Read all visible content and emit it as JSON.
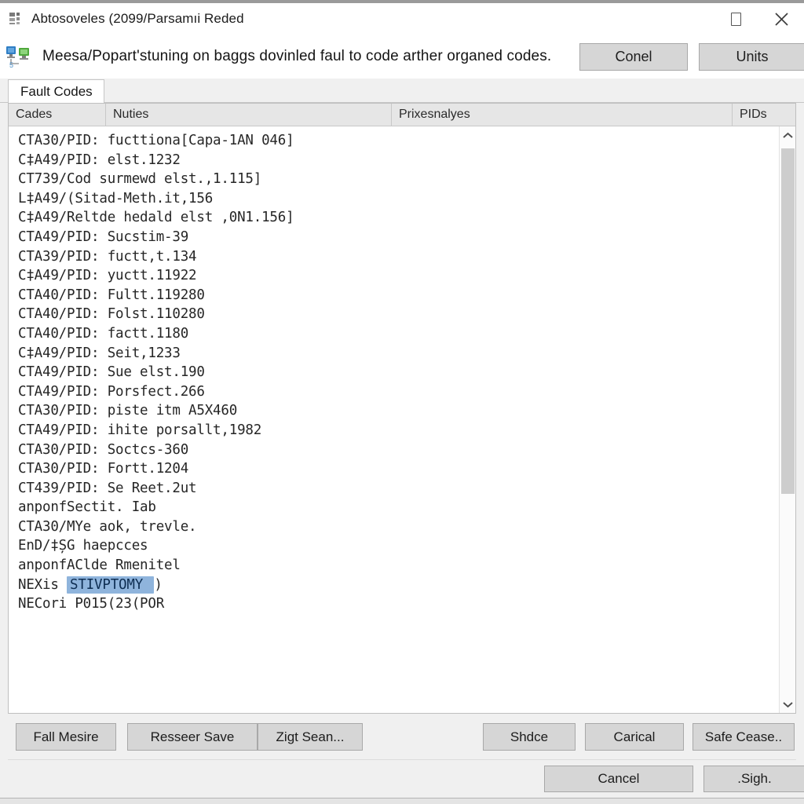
{
  "window": {
    "title": "Abtosoveles (2099/Parsamıi Reded",
    "title_icon": "app-grid-icon",
    "controls": {
      "maximize": "maximize-icon",
      "close": "close-icon"
    }
  },
  "banner": {
    "icon": "network-computers-icon",
    "message": "Meesa/Popart'stuning on baggs dovinled faul to code arther organed codes.",
    "buttons": [
      {
        "name": "conel-button",
        "label": "Conel"
      },
      {
        "name": "units-button",
        "label": "Units"
      }
    ]
  },
  "tabs": [
    {
      "name": "tab-fault-codes",
      "label": "Fault Codes",
      "active": true
    }
  ],
  "table": {
    "columns": [
      {
        "key": "codes",
        "label": "Cades"
      },
      {
        "key": "nuties",
        "label": "Nuties"
      },
      {
        "key": "analyses",
        "label": "Prixesnalyes"
      },
      {
        "key": "pids",
        "label": "PIDs"
      }
    ],
    "rows": [
      {
        "text": "CTA30/PID: fucttiona[Capa-1AN 046]"
      },
      {
        "text": "C‡A49/PID: elst.1232"
      },
      {
        "text": "CT739/Cod surmewd elst.,1.115]"
      },
      {
        "text": "L‡A49/(Sitad-Meth.it,156"
      },
      {
        "text": "C‡A49/Reltde hedald elst ,0N1.156]"
      },
      {
        "text": "CTA49/PID: Sucstim-39"
      },
      {
        "text": "CTA39/PID: fuctt,t.134"
      },
      {
        "text": "C‡A49/PID: yuctt.11922"
      },
      {
        "text": "CTA40/PID: Fultt.119280"
      },
      {
        "text": "CTA40/PID: Folst.110280"
      },
      {
        "text": "CTA40/PID: factt.1180"
      },
      {
        "text": "C‡A49/PID: Seit,1233"
      },
      {
        "text": "CTA49/PID: Sue elst.190"
      },
      {
        "text": "CTA49/PID: Porsfect.266"
      },
      {
        "text": "CTA30/PID: piste itm A5X460"
      },
      {
        "text": "CTA49/PID: ihite porsallt,1982"
      },
      {
        "text": "CTA30/PID: Soctcs-360"
      },
      {
        "text": "CTA30/PID: Fortt.1204"
      },
      {
        "text": "CT439/PID: Se Reet.2ut"
      },
      {
        "text": "anponfSectit. Iab"
      },
      {
        "text": "CTA30/MYe aok, trevle."
      },
      {
        "text": "EnD/‡ȘG haepcces"
      },
      {
        "text": "anponfAClde Rmenitel"
      },
      {
        "text": "NEXis ",
        "selected": "STIVPTOMY ",
        "suffix": ")"
      },
      {
        "text": "NECori P015(23(POR"
      }
    ]
  },
  "scrollbar": {
    "up_arrow": "chevron-up-icon",
    "down_arrow": "chevron-down-icon"
  },
  "actions": [
    {
      "name": "fall-mesire-button",
      "label": "Fall Mesire"
    },
    {
      "name": "resseer-save-button",
      "label": "Resseer Save"
    },
    {
      "name": "zigt-sean-button",
      "label": "Zigt Sean..."
    },
    {
      "name": "shdce-button",
      "label": "Shdce"
    },
    {
      "name": "carical-button",
      "label": "Carical"
    },
    {
      "name": "safe-cease-button",
      "label": "Safe Cease.."
    }
  ],
  "footer": [
    {
      "name": "cancel-button",
      "label": "Cancel"
    },
    {
      "name": "sign-button",
      "label": ".Sigh."
    }
  ],
  "colors": {
    "selection": "#8fb4dc",
    "button_face": "#d6d6d6",
    "panel_bg": "#ffffff",
    "dialog_bg": "#f0f0f0"
  }
}
